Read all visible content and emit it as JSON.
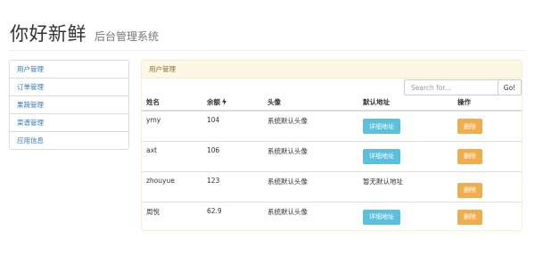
{
  "header": {
    "brand": "你好新鲜",
    "subtitle": "后台管理系统"
  },
  "sidebar": {
    "items": [
      {
        "label": "用户管理"
      },
      {
        "label": "订单管理"
      },
      {
        "label": "果蔬管理"
      },
      {
        "label": "菜谱管理"
      },
      {
        "label": "应用信息"
      }
    ]
  },
  "panel": {
    "title": "用户管理",
    "search": {
      "placeholder": "Search for...",
      "button": "Go!"
    },
    "columns": [
      "姓名",
      "余额",
      "头像",
      "默认地址",
      "操作"
    ],
    "sort_icon": "bolt-icon",
    "rows": [
      {
        "name": "ymy",
        "balance": "104",
        "avatar": "系统默认头像",
        "address_button": "详细地址",
        "action": "删除"
      },
      {
        "name": "axt",
        "balance": "106",
        "avatar": "系统默认头像",
        "address_button": "详细地址",
        "action": "删除"
      },
      {
        "name": "zhouyue",
        "balance": "123",
        "avatar": "系统默认头像",
        "address_text": "暂无默认地址",
        "action": "删除"
      },
      {
        "name": "周悦",
        "balance": "62.9",
        "avatar": "系统默认头像",
        "address_button": "详细地址",
        "action": "删除"
      }
    ]
  },
  "colors": {
    "info": "#5bc0de",
    "warning": "#f0ad4e",
    "panel_heading_bg": "#fcf8e3",
    "link": "#337ab7"
  }
}
